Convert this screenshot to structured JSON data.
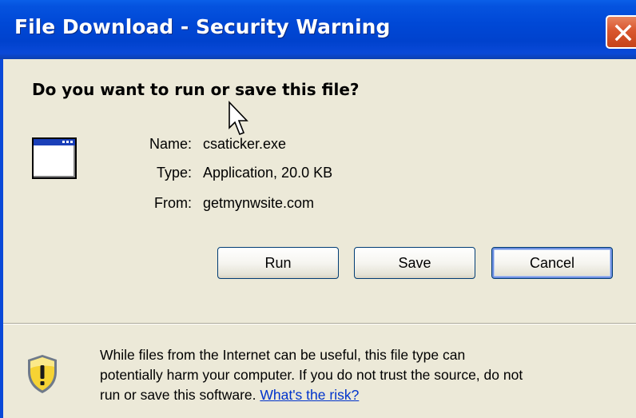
{
  "window": {
    "title": "File Download - Security Warning"
  },
  "dialog": {
    "question": "Do you want to run or save this file?",
    "fields": [
      {
        "label": "Name:",
        "value": "csaticker.exe"
      },
      {
        "label": "Type:",
        "value": "Application, 20.0 KB"
      },
      {
        "label": "From:",
        "value": "getmynwsite.com"
      }
    ],
    "buttons": {
      "run": "Run",
      "save": "Save",
      "cancel": "Cancel"
    },
    "warning": {
      "line1": "While files from the Internet can be useful, this file type can",
      "line2": "potentially harm your computer. If you do not trust the source, do not",
      "line3_text": "run or save this software.",
      "link": "What's the risk?"
    }
  },
  "icons": {
    "close": "close-icon",
    "application": "application-icon",
    "shield": "security-shield-icon",
    "cursor": "mouse-cursor-icon"
  },
  "colors": {
    "titlebar": "#0048d6",
    "close_button": "#d9572f",
    "dialog_background": "#ece9d8",
    "link": "#0033cc"
  }
}
